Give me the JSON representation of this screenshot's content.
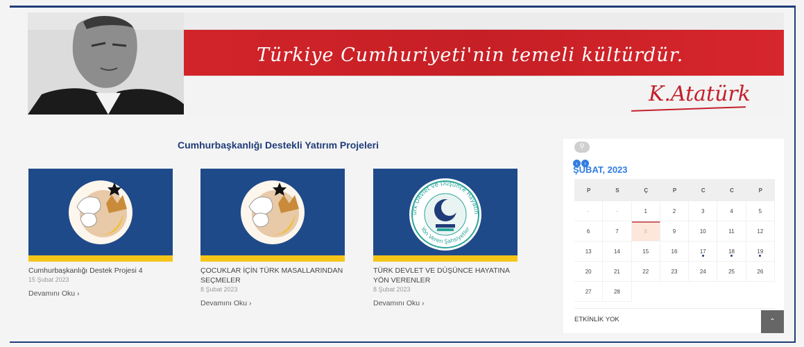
{
  "banner": {
    "quote": "Türkiye Cumhuriyeti'nin temeli kültürdür.",
    "signature": "K.Atatürk"
  },
  "section": {
    "title": "Cumhurbaşkanlığı Destekli Yatırım Projeleri"
  },
  "cards": [
    {
      "title": "Cumhurbaşkanlığı Destek Projesi 4",
      "date": "15 Şubat 2023",
      "more": "Devamını Oku  ›"
    },
    {
      "title": "ÇOCUKLAR İÇİN TÜRK MASALLARINDAN SEÇMELER",
      "date": "8 Şubat 2023",
      "more": "Devamını Oku  ›"
    },
    {
      "title": "TÜRK DEVLET VE DÜŞÜNCE HAYATINA YÖN VERENLER",
      "date": "8 Şubat 2023",
      "more": "Devamını Oku  ›",
      "logo_text_top": "Türk Devlet ve Düşünce Hayatına",
      "logo_text_bottom": "Yön Veren Şahsiyetler"
    }
  ],
  "calendar": {
    "search_icon": "search-icon",
    "prev_label": "‹",
    "next_label": "›",
    "month": "ŞUBAT, 2023",
    "weekdays": [
      "P",
      "S",
      "Ç",
      "P",
      "C",
      "C",
      "P"
    ],
    "weeks": [
      [
        "-",
        "-",
        "1",
        "2",
        "3",
        "4",
        "5"
      ],
      [
        "6",
        "7",
        "8",
        "9",
        "10",
        "11",
        "12"
      ],
      [
        "13",
        "14",
        "15",
        "16",
        "17",
        "18",
        "19"
      ],
      [
        "20",
        "21",
        "22",
        "23",
        "24",
        "25",
        "26"
      ],
      [
        "27",
        "28",
        "",
        "",
        "",
        "",
        ""
      ]
    ],
    "event_days": [
      "17",
      "18",
      "19"
    ],
    "today": "8",
    "no_event": "ETKİNLİK YOK"
  },
  "scroll_top_label": "⌃",
  "colors": {
    "navy": "#1f3c78",
    "banner_red": "#d7262d",
    "accent_blue": "#2f7de1",
    "card_blue": "#1f4a8a",
    "card_yellow": "#f5c518"
  }
}
